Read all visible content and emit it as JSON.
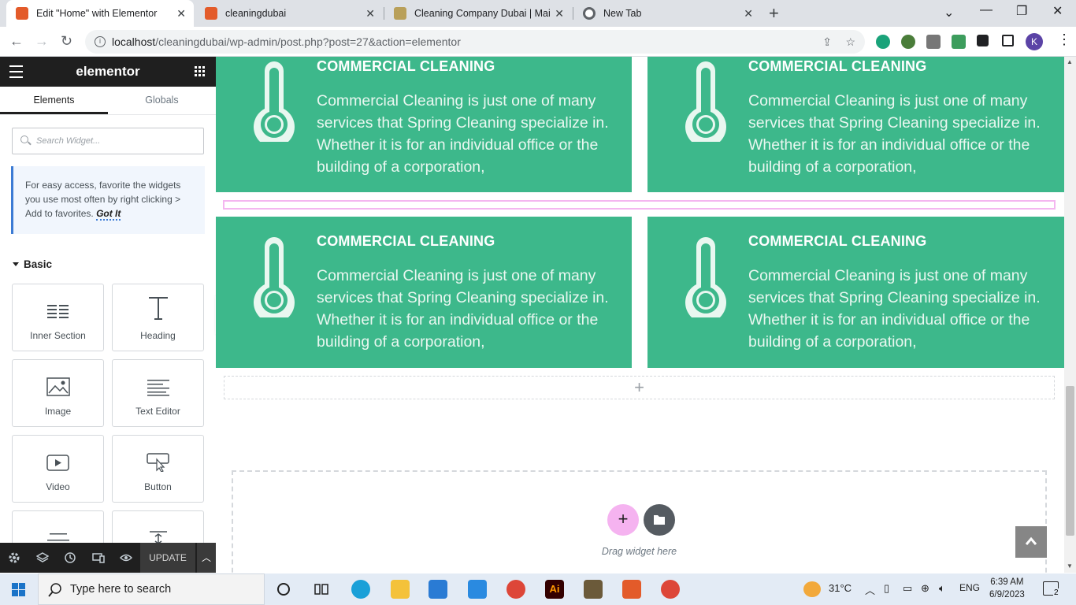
{
  "browser": {
    "tabs": [
      {
        "title": "Edit \"Home\" with Elementor",
        "color": "#e35b2a",
        "active": true
      },
      {
        "title": "cleaningdubai",
        "color": "#e35b2a"
      },
      {
        "title": "Cleaning Company Dubai | Maid",
        "color": "#b9a05a"
      },
      {
        "title": "New Tab",
        "color": "#5f6368"
      }
    ],
    "url_host": "localhost",
    "url_path": "/cleaningdubai/wp-admin/post.php?post=27&action=elementor",
    "profile_initial": "K"
  },
  "editor": {
    "brand": "elementor",
    "tabs": [
      "Elements",
      "Globals"
    ],
    "search_placeholder": "Search Widget...",
    "tip_text": "For easy access, favorite the widgets you use most often by right clicking > Add to favorites.",
    "tip_link": "Got It",
    "category": "Basic",
    "widgets": [
      "Inner Section",
      "Heading",
      "Image",
      "Text Editor",
      "Video",
      "Button"
    ],
    "update_label": "UPDATE"
  },
  "canvas": {
    "cards": [
      {
        "title": "COMMERCIAL CLEANING",
        "text": "Commercial Cleaning is just one of many services that Spring Cleaning specialize in. Whether it is for an individual office or the building of a corporation,"
      },
      {
        "title": "COMMERCIAL CLEANING",
        "text": "Commercial Cleaning is just one of many services that Spring Cleaning specialize in. Whether it is for an individual office or the building of a corporation,"
      },
      {
        "title": "COMMERCIAL CLEANING",
        "text": "Commercial Cleaning is just one of many services that Spring Cleaning specialize in. Whether it is for an individual office or the building of a corporation,"
      },
      {
        "title": "COMMERCIAL CLEANING",
        "text": "Commercial Cleaning is just one of many services that Spring Cleaning specialize in. Whether it is for an individual office or the building of a corporation,"
      }
    ],
    "drop_hint": "Drag widget here",
    "accent": "#3db88b"
  },
  "taskbar": {
    "search_placeholder": "Type here to search",
    "temperature": "31°C",
    "language": "ENG",
    "time": "6:39 AM",
    "date": "6/9/2023",
    "notifications": "2"
  }
}
